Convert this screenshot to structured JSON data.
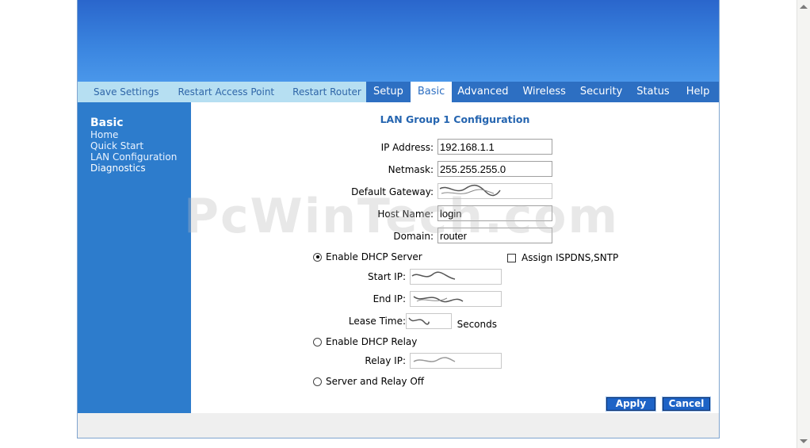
{
  "toolbar": [
    "Save Settings",
    "Restart Access Point",
    "Restart Router"
  ],
  "tabs": [
    "Setup",
    "Basic",
    "Advanced",
    "Wireless",
    "Security",
    "Status",
    "Help"
  ],
  "sidebar": {
    "title": "Basic",
    "items": [
      "Home",
      "Quick Start",
      "LAN Configuration",
      "Diagnostics"
    ]
  },
  "page_title": "LAN Group 1 Configuration",
  "form": {
    "ip_label": "IP Address:",
    "ip_value": "192.168.1.1",
    "netmask_label": "Netmask:",
    "netmask_value": "255.255.255.0",
    "gateway_label": "Default Gateway:",
    "hostname_label": "Host Name:",
    "hostname_value": "login",
    "domain_label": "Domain:",
    "domain_value": "router"
  },
  "dhcp": {
    "server_label": "Enable DHCP Server",
    "server_selected": true,
    "assign_label": "Assign ISPDNS,SNTP",
    "assign_checked": false,
    "start_ip_label": "Start IP:",
    "end_ip_label": "End IP:",
    "lease_label": "Lease Time:",
    "seconds_label": "Seconds",
    "relay_label": "Enable DHCP Relay",
    "relay_ip_label": "Relay IP:",
    "off_label": "Server and Relay Off"
  },
  "buttons": {
    "apply": "Apply",
    "cancel": "Cancel"
  },
  "watermark": "PcWinTech.com",
  "colors": {
    "accent": "#2d6fc2",
    "toolbar_bg": "#b6dff2",
    "sidebar_bg": "#2d7ccc",
    "title": "#2565b0"
  }
}
